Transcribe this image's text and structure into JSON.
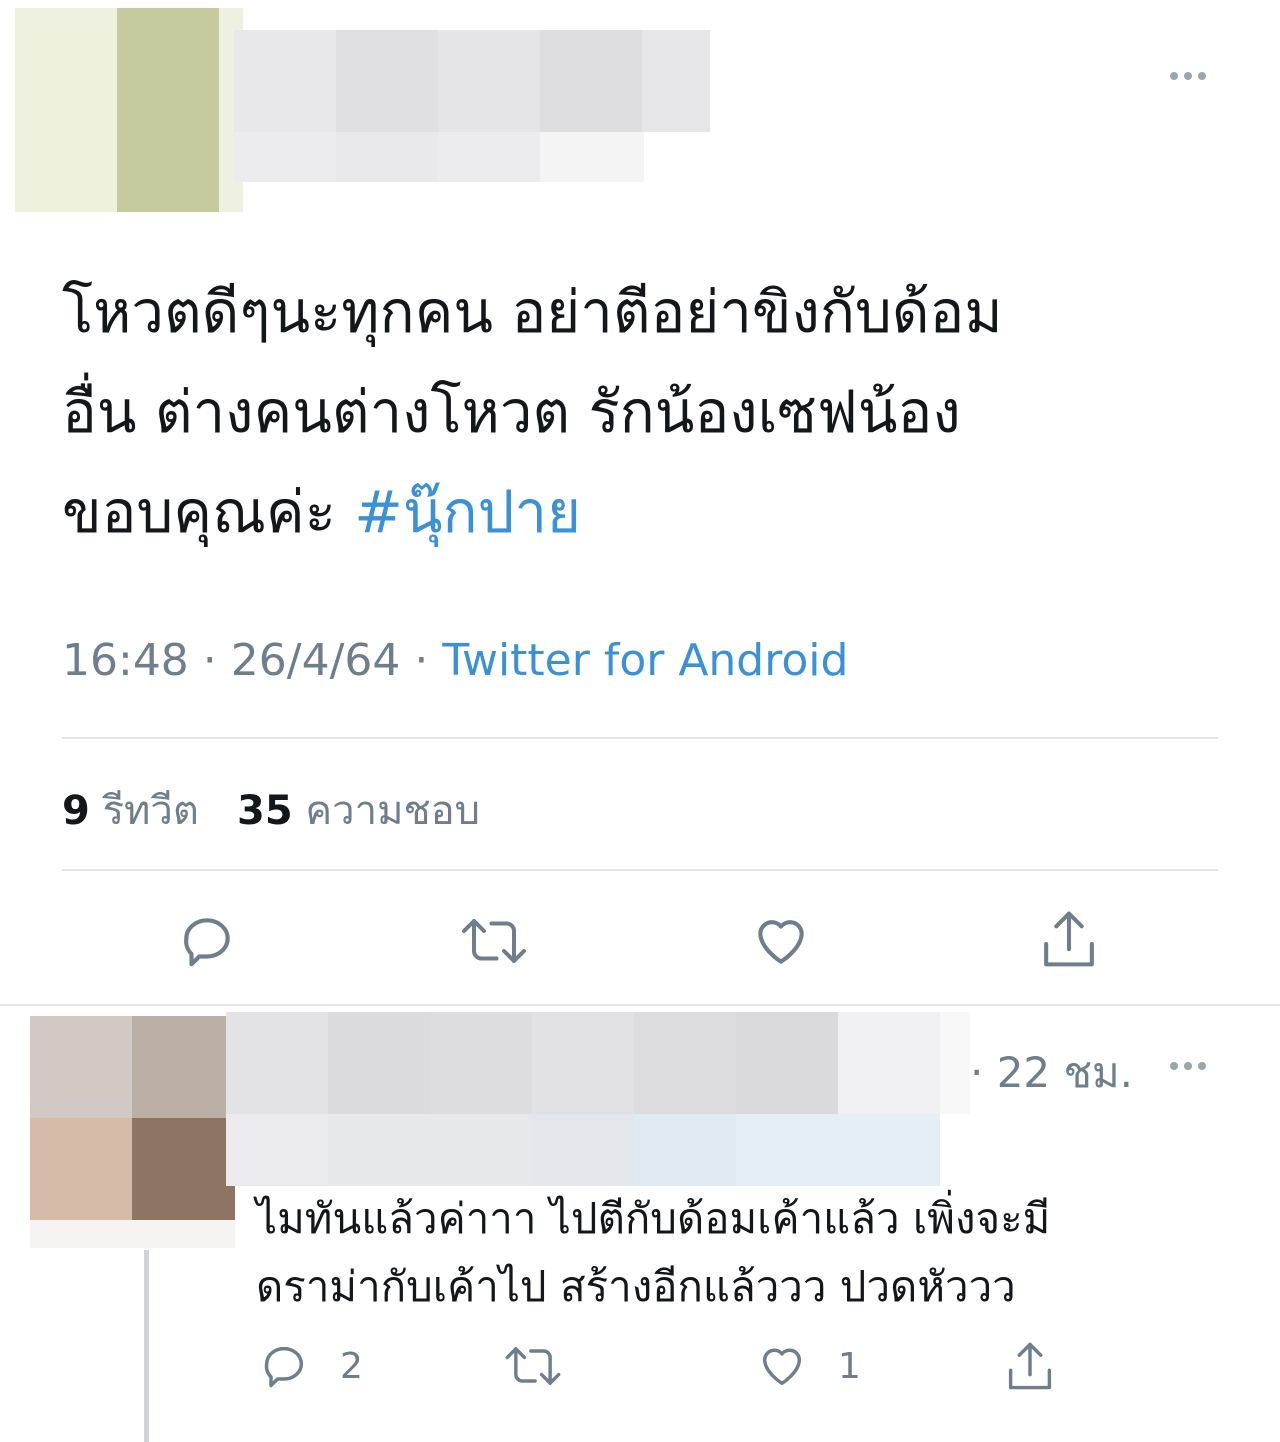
{
  "tweet": {
    "text": "โหวตดีๆนะทุกคน อย่าตีอย่าขิงกับด้อม\nอื่น ต่างคนต่างโหวต รักน้องเซฟน้อง\nขอบคุณค่ะ ",
    "hashtag": "#นุ๊กปาย",
    "time": "16:48",
    "sep1": " · ",
    "date": "26/4/64",
    "sep2": " · ",
    "source": "Twitter for Android",
    "retweet_count": "9",
    "retweet_label": "รีทวีต",
    "like_count": "35",
    "like_label": "ความชอบ",
    "actions": {
      "reply_icon": "reply-icon",
      "retweet_icon": "retweet-icon",
      "like_icon": "heart-icon",
      "share_icon": "share-icon"
    }
  },
  "reply": {
    "time": "· 22 ชม.",
    "text": "ไมทันแล้วค่าาา ไปตีกับด้อมเค้าแล้ว เพิ่งจะมี\nดราม่ากับเค้าไป สร้างอีกแล้ววว ปวดหัววว",
    "reply_count": "2",
    "like_count": "1"
  },
  "colors": {
    "accent": "#3b91d6",
    "muted": "#6f7e8b",
    "text": "#14171a"
  }
}
